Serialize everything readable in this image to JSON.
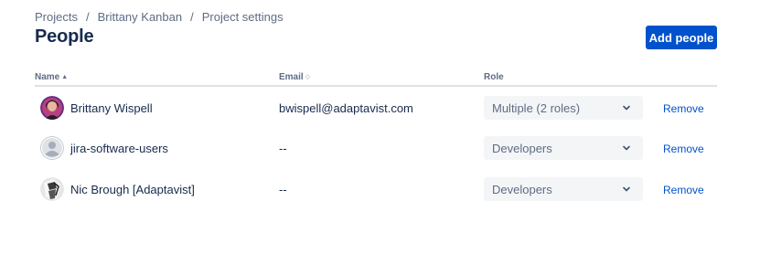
{
  "breadcrumb": {
    "items": [
      "Projects",
      "Brittany Kanban",
      "Project settings"
    ],
    "separator": "/"
  },
  "page": {
    "title": "People"
  },
  "actions": {
    "add_people_label": "Add people"
  },
  "table": {
    "columns": {
      "name": "Name",
      "email": "Email",
      "role": "Role"
    },
    "rows": [
      {
        "name": "Brittany Wispell",
        "email": "bwispell@adaptavist.com",
        "role": "Multiple (2 roles)",
        "action": "Remove",
        "avatar": "photo-avatar"
      },
      {
        "name": "jira-software-users",
        "email": "--",
        "role": "Developers",
        "action": "Remove",
        "avatar": "default-user-avatar"
      },
      {
        "name": "Nic Brough [Adaptavist]",
        "email": "--",
        "role": "Developers",
        "action": "Remove",
        "avatar": "photo-avatar"
      }
    ]
  },
  "colors": {
    "primary": "#0052cc",
    "text": "#172b4d",
    "subtle": "#5e6c84",
    "select_bg": "#f4f5f7"
  }
}
